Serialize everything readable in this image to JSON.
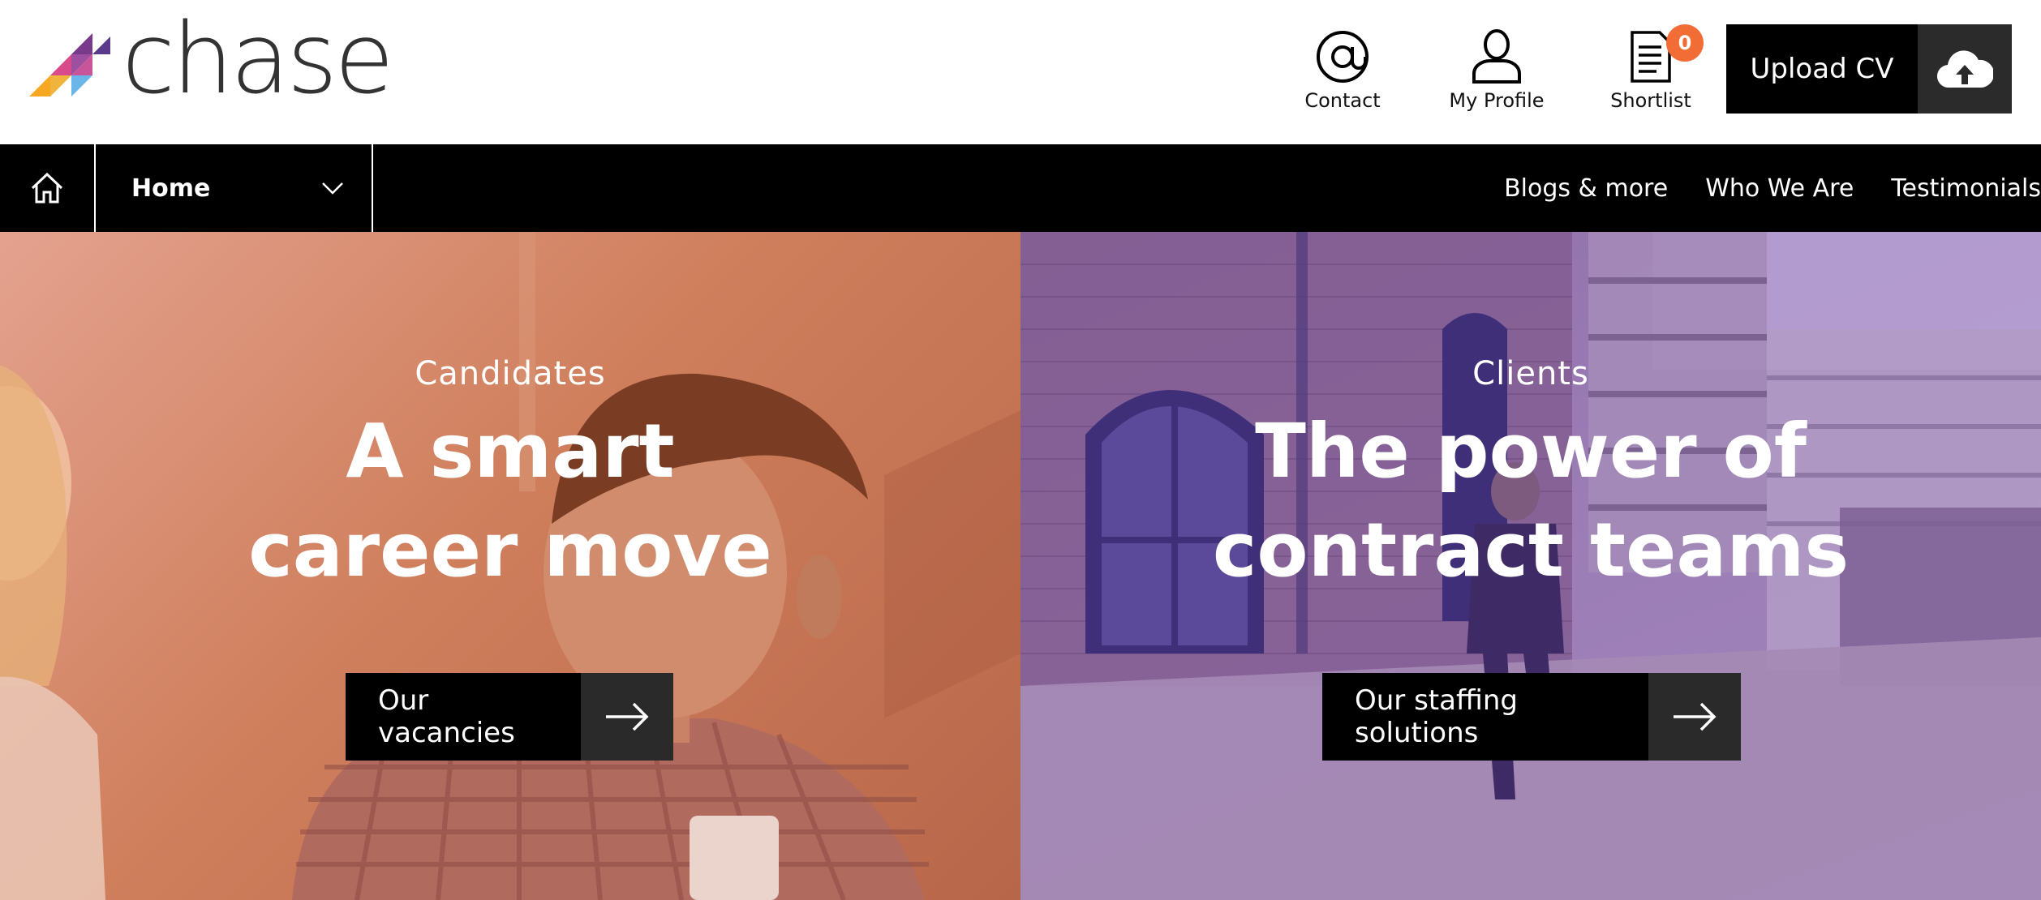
{
  "brand": {
    "name": "chase",
    "colors": [
      "#f6a823",
      "#8a3d8f",
      "#d94a8a",
      "#5aa9e0"
    ]
  },
  "header": {
    "links": [
      {
        "label": "Contact",
        "icon": "at-icon"
      },
      {
        "label": "My Profile",
        "icon": "user-icon"
      },
      {
        "label": "Shortlist",
        "icon": "document-icon",
        "badge": "0"
      }
    ],
    "upload": {
      "label": "Upload CV",
      "icon": "cloud-upload-icon"
    }
  },
  "nav": {
    "home_icon": "home-icon",
    "select_value": "Home",
    "links": [
      "Blogs & more",
      "Who We Are",
      "Testimonials"
    ]
  },
  "hero": {
    "left": {
      "eyebrow": "Candidates",
      "headline_line1": "A smart",
      "headline_line2": "career move",
      "cta": "Our vacancies",
      "overlay_color": "#d9845f"
    },
    "right": {
      "eyebrow": "Clients",
      "headline_line1": "The power of",
      "headline_line2": "contract teams",
      "cta": "Our staffing solutions",
      "overlay_color": "#9a7bb4"
    }
  },
  "accent": {
    "badge": "#f26d36",
    "cta_bg": "#000000",
    "cta_arrow_bg": "#2a2a2a"
  }
}
